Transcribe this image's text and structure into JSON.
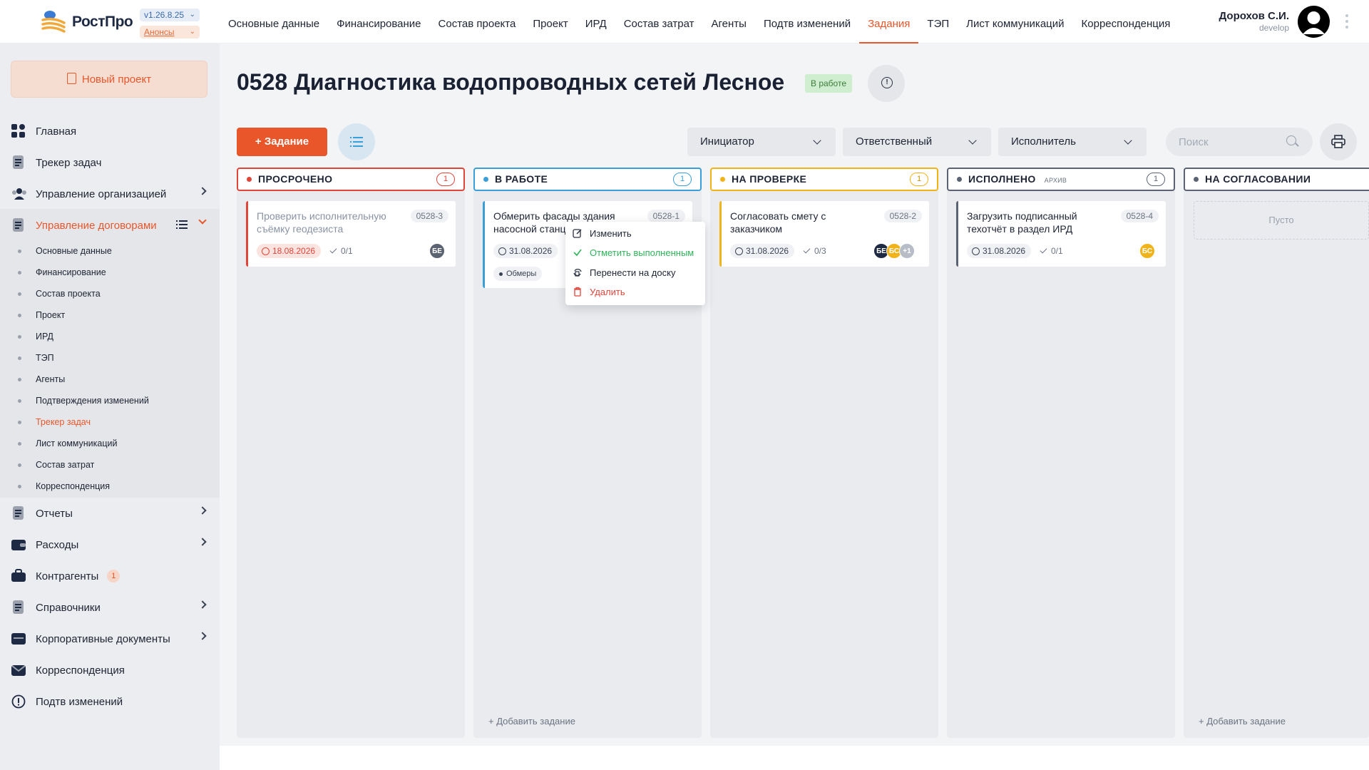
{
  "brand": {
    "name": "РостПро",
    "version": "v1.26.8.25",
    "announcements": "Анонсы"
  },
  "topnav": {
    "items": [
      "Основные данные",
      "Финансирование",
      "Состав проекта",
      "Проект",
      "ИРД",
      "Состав затрат",
      "Агенты",
      "Подтв изменений",
      "Задания",
      "ТЭП",
      "Лист коммуникаций",
      "Корреспонденция"
    ],
    "active": "Задания",
    "user": {
      "name": "Дорохов С.И.",
      "role": "develop"
    }
  },
  "sidebar": {
    "new_project": "Новый проект",
    "items": [
      {
        "label": "Главная",
        "icon": "grid-icon"
      },
      {
        "label": "Трекер задач",
        "icon": "document-icon"
      },
      {
        "label": "Управление организацией",
        "icon": "users-icon",
        "chevron": true
      },
      {
        "label": "Управление договорами",
        "icon": "contract-icon",
        "open": true
      },
      {
        "label": "Отчеты",
        "icon": "report-icon",
        "chevron": true
      },
      {
        "label": "Расходы",
        "icon": "wallet-icon",
        "chevron": true
      },
      {
        "label": "Контрагенты",
        "icon": "briefcase-icon",
        "badge": "1"
      },
      {
        "label": "Справочники",
        "icon": "book-icon",
        "chevron": true
      },
      {
        "label": "Корпоративные документы",
        "icon": "folder-icon",
        "chevron": true
      },
      {
        "label": "Корреспонденция",
        "icon": "mail-icon"
      },
      {
        "label": "Подтв изменений",
        "icon": "alert-icon"
      }
    ],
    "sub_items": [
      "Основные данные",
      "Финансирование",
      "Состав проекта",
      "Проект",
      "ИРД",
      "ТЭП",
      "Агенты",
      "Подтверждения изменений",
      "Трекер задач",
      "Лист коммуникаций",
      "Состав затрат",
      "Корреспонденция"
    ],
    "active_sub": "Трекер задач"
  },
  "page": {
    "title": "0528 Диагностика водопроводных сетей Лесное",
    "status": "В работе"
  },
  "toolbar": {
    "add_task": "+ Задание",
    "filters": [
      "Инициатор",
      "Ответственный",
      "Исполнитель"
    ],
    "search_placeholder": "Поиск"
  },
  "board": {
    "columns": [
      {
        "title": "ПРОСРОЧЕНО",
        "count": "1",
        "color": "#e0453a"
      },
      {
        "title": "В РАБОТЕ",
        "count": "1",
        "color": "#3a9fd8"
      },
      {
        "title": "НА ПРОВЕРКЕ",
        "count": "1",
        "color": "#f0b31a"
      },
      {
        "title": "ИСПОЛНЕНО",
        "count": "1",
        "color": "#5b6373",
        "badge": "АРХИВ"
      },
      {
        "title": "НА СОГЛАСОВАНИИ",
        "count": "",
        "color": "#5b6373"
      }
    ],
    "cards": [
      {
        "title": "Проверить исполнительную съёмку геодезиста",
        "code": "0528-3",
        "date": "18.08.2026",
        "checks": "0/1",
        "avatars": [
          "БЕ"
        ]
      },
      {
        "title": "Обмерить фасады здания насосной станц",
        "code": "0528-1",
        "date": "31.08.2026",
        "checks": "",
        "tag": "Обмеры"
      },
      {
        "title": "Согласовать смету с заказчиком",
        "code": "0528-2",
        "date": "31.08.2026",
        "checks": "0/3",
        "avatars": [
          "БЕ",
          "БС",
          "+1"
        ]
      },
      {
        "title": "Загрузить подписанный техотчёт в раздел ИРД",
        "code": "0528-4",
        "date": "31.08.2026",
        "checks": "0/1",
        "avatars": [
          "БС"
        ]
      }
    ],
    "add_task_label": "+ Добавить задание",
    "empty_label": "Пусто"
  },
  "context_menu": {
    "items": [
      "Изменить",
      "Отметить выполненным",
      "Перенести на доску",
      "Удалить"
    ]
  },
  "colors": {
    "accent": "#e8562a",
    "overdue": "#e0453a",
    "in_progress": "#3a9fd8",
    "review": "#f0b31a",
    "done": "#5b6373",
    "success": "#2fb45a"
  }
}
